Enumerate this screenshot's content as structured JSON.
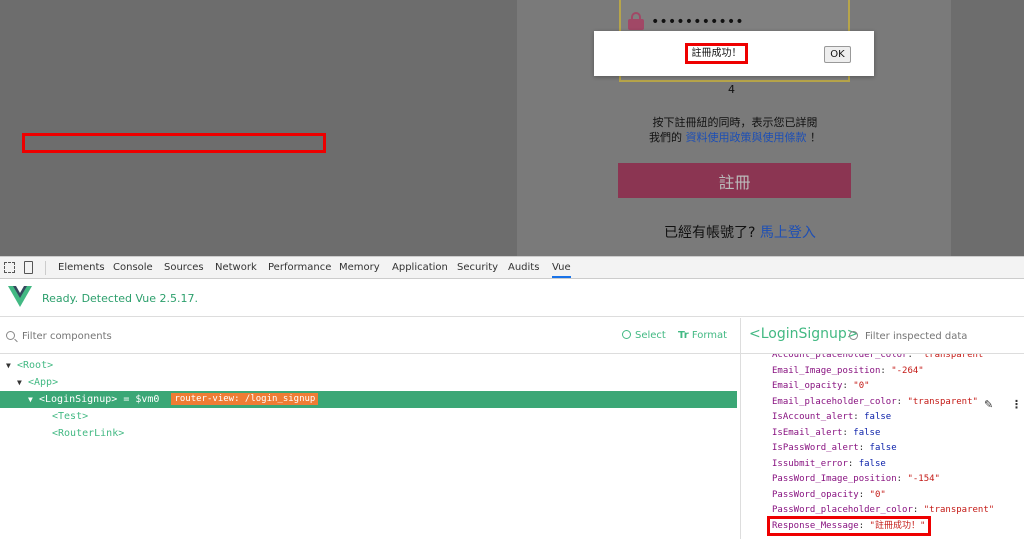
{
  "page": {
    "password_dots": "•••••••••••",
    "counter": "4",
    "terms_line1": "按下註冊紐的同時，表示您已詳閱",
    "terms_line2_prefix": "我們的",
    "terms_link": "資料使用政策與使用條款",
    "terms_line2_suffix": "！",
    "register_button": "註冊",
    "login_prompt": "已經有帳號了?",
    "login_link": "馬上登入"
  },
  "alert": {
    "message": "註冊成功！",
    "ok_label": "OK"
  },
  "devtools": {
    "tabs": [
      "Elements",
      "Console",
      "Sources",
      "Network",
      "Performance",
      "Memory",
      "Application",
      "Security",
      "Audits",
      "Vue"
    ],
    "active_tab": "Vue",
    "vue_status": "Ready. Detected Vue 2.5.17.",
    "filter_placeholder": "Filter components",
    "select_label": "Select",
    "format_label": "Format",
    "tree": {
      "root": "<Root>",
      "app": "<App>",
      "login_signup": "<LoginSignup>",
      "vm_ref": "= $vm0",
      "route_badge": "router-view: /login_signup",
      "test": "<Test>",
      "router_link": "<RouterLink>"
    },
    "inspected_name": "<LoginSignup>",
    "inspect_placeholder": "Filter inspected data",
    "props": [
      {
        "key": "Account_placeholder_color",
        "value": "\"transparent\"",
        "type": "str"
      },
      {
        "key": "Email_Image_position",
        "value": "\"-264\"",
        "type": "str"
      },
      {
        "key": "Email_opacity",
        "value": "\"0\"",
        "type": "str"
      },
      {
        "key": "Email_placeholder_color",
        "value": "\"transparent\"",
        "type": "str"
      },
      {
        "key": "IsAccount_alert",
        "value": "false",
        "type": "bool"
      },
      {
        "key": "IsEmail_alert",
        "value": "false",
        "type": "bool"
      },
      {
        "key": "IsPassWord_alert",
        "value": "false",
        "type": "bool"
      },
      {
        "key": "Issubmit_error",
        "value": "false",
        "type": "bool"
      },
      {
        "key": "PassWord_Image_position",
        "value": "\"-154\"",
        "type": "str"
      },
      {
        "key": "PassWord_opacity",
        "value": "\"0\"",
        "type": "str"
      },
      {
        "key": "PassWord_placeholder_color",
        "value": "\"transparent\"",
        "type": "str"
      },
      {
        "key": "Response_Message",
        "value": "\"註冊成功！\"",
        "type": "str"
      }
    ]
  },
  "colors": {
    "vue_green": "#42b983",
    "selected_row": "#3ba776",
    "route_badge": "#ef7c34",
    "highlight_red": "#e00"
  }
}
